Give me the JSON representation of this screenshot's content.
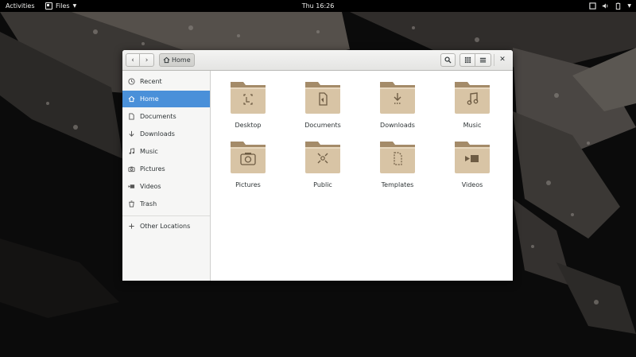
{
  "topbar": {
    "activities": "Activities",
    "app_name": "Files",
    "clock": "Thu 16:26"
  },
  "window": {
    "path_location": "Home",
    "sidebar": {
      "items": [
        {
          "label": "Recent",
          "icon": "clock-icon"
        },
        {
          "label": "Home",
          "icon": "home-icon",
          "active": true
        },
        {
          "label": "Documents",
          "icon": "document-icon"
        },
        {
          "label": "Downloads",
          "icon": "download-icon"
        },
        {
          "label": "Music",
          "icon": "music-icon"
        },
        {
          "label": "Pictures",
          "icon": "camera-icon"
        },
        {
          "label": "Videos",
          "icon": "video-icon"
        },
        {
          "label": "Trash",
          "icon": "trash-icon"
        }
      ],
      "other": {
        "label": "Other Locations",
        "icon": "plus-icon"
      }
    },
    "folders": [
      {
        "label": "Desktop",
        "icon": "desktop-folder-icon"
      },
      {
        "label": "Documents",
        "icon": "documents-folder-icon"
      },
      {
        "label": "Downloads",
        "icon": "downloads-folder-icon"
      },
      {
        "label": "Music",
        "icon": "music-folder-icon"
      },
      {
        "label": "Pictures",
        "icon": "pictures-folder-icon"
      },
      {
        "label": "Public",
        "icon": "public-folder-icon"
      },
      {
        "label": "Templates",
        "icon": "templates-folder-icon"
      },
      {
        "label": "Videos",
        "icon": "videos-folder-icon"
      }
    ]
  },
  "colors": {
    "accent": "#4a90d9",
    "folder_body": "#d8c4a5",
    "folder_tab": "#a48b69"
  }
}
